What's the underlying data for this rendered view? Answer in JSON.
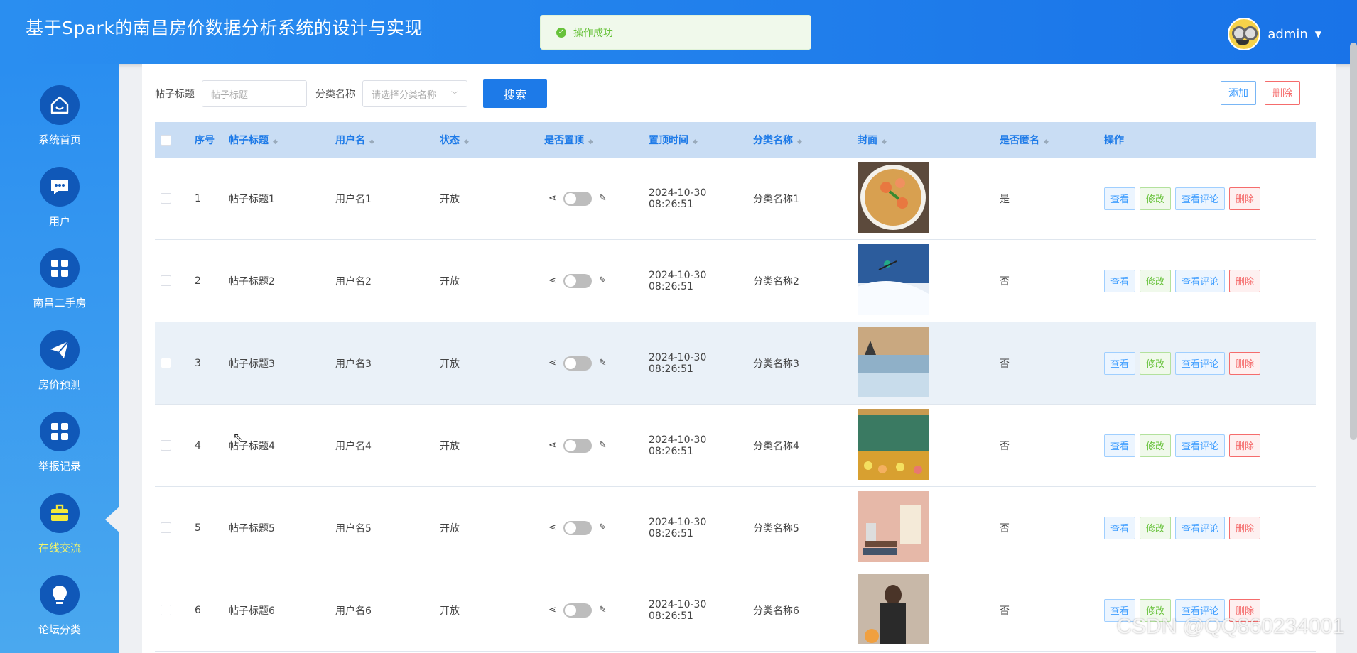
{
  "app": {
    "title": "基于Spark的南昌房价数据分析系统的设计与实现"
  },
  "user": {
    "name": "admin"
  },
  "toast": {
    "message": "操作成功"
  },
  "sidebar": {
    "items": [
      {
        "label": "系统首页",
        "icon": "home-icon"
      },
      {
        "label": "用户",
        "icon": "chat-icon"
      },
      {
        "label": "南昌二手房",
        "icon": "grid-icon"
      },
      {
        "label": "房价预测",
        "icon": "send-icon"
      },
      {
        "label": "举报记录",
        "icon": "grid-icon"
      },
      {
        "label": "在线交流",
        "icon": "briefcase-icon",
        "active": true
      },
      {
        "label": "论坛分类",
        "icon": "bulb-icon"
      }
    ]
  },
  "search": {
    "title_label": "帖子标题",
    "title_placeholder": "帖子标题",
    "category_label": "分类名称",
    "category_placeholder": "请选择分类名称",
    "search_button": "搜索"
  },
  "actions": {
    "add": "添加",
    "delete": "删除"
  },
  "table": {
    "headers": {
      "index": "序号",
      "title": "帖子标题",
      "user": "用户名",
      "status": "状态",
      "pinned": "是否置顶",
      "pin_time": "置顶时间",
      "category": "分类名称",
      "cover": "封面",
      "anonymous": "是否匿名",
      "ops": "操作"
    },
    "op_labels": {
      "view": "查看",
      "edit": "修改",
      "comments": "查看评论",
      "delete": "删除"
    },
    "rows": [
      {
        "index": "1",
        "title": "帖子标题1",
        "user": "用户名1",
        "status": "开放",
        "pin_time": "2024-10-30 08:26:51",
        "category": "分类名称1",
        "anonymous": "是"
      },
      {
        "index": "2",
        "title": "帖子标题2",
        "user": "用户名2",
        "status": "开放",
        "pin_time": "2024-10-30 08:26:51",
        "category": "分类名称2",
        "anonymous": "否"
      },
      {
        "index": "3",
        "title": "帖子标题3",
        "user": "用户名3",
        "status": "开放",
        "pin_time": "2024-10-30 08:26:51",
        "category": "分类名称3",
        "anonymous": "否"
      },
      {
        "index": "4",
        "title": "帖子标题4",
        "user": "用户名4",
        "status": "开放",
        "pin_time": "2024-10-30 08:26:51",
        "category": "分类名称4",
        "anonymous": "否"
      },
      {
        "index": "5",
        "title": "帖子标题5",
        "user": "用户名5",
        "status": "开放",
        "pin_time": "2024-10-30 08:26:51",
        "category": "分类名称5",
        "anonymous": "否"
      },
      {
        "index": "6",
        "title": "帖子标题6",
        "user": "用户名6",
        "status": "开放",
        "pin_time": "2024-10-30 08:26:51",
        "category": "分类名称6",
        "anonymous": "否"
      }
    ]
  },
  "watermark": "CSDN @QQ860234001"
}
